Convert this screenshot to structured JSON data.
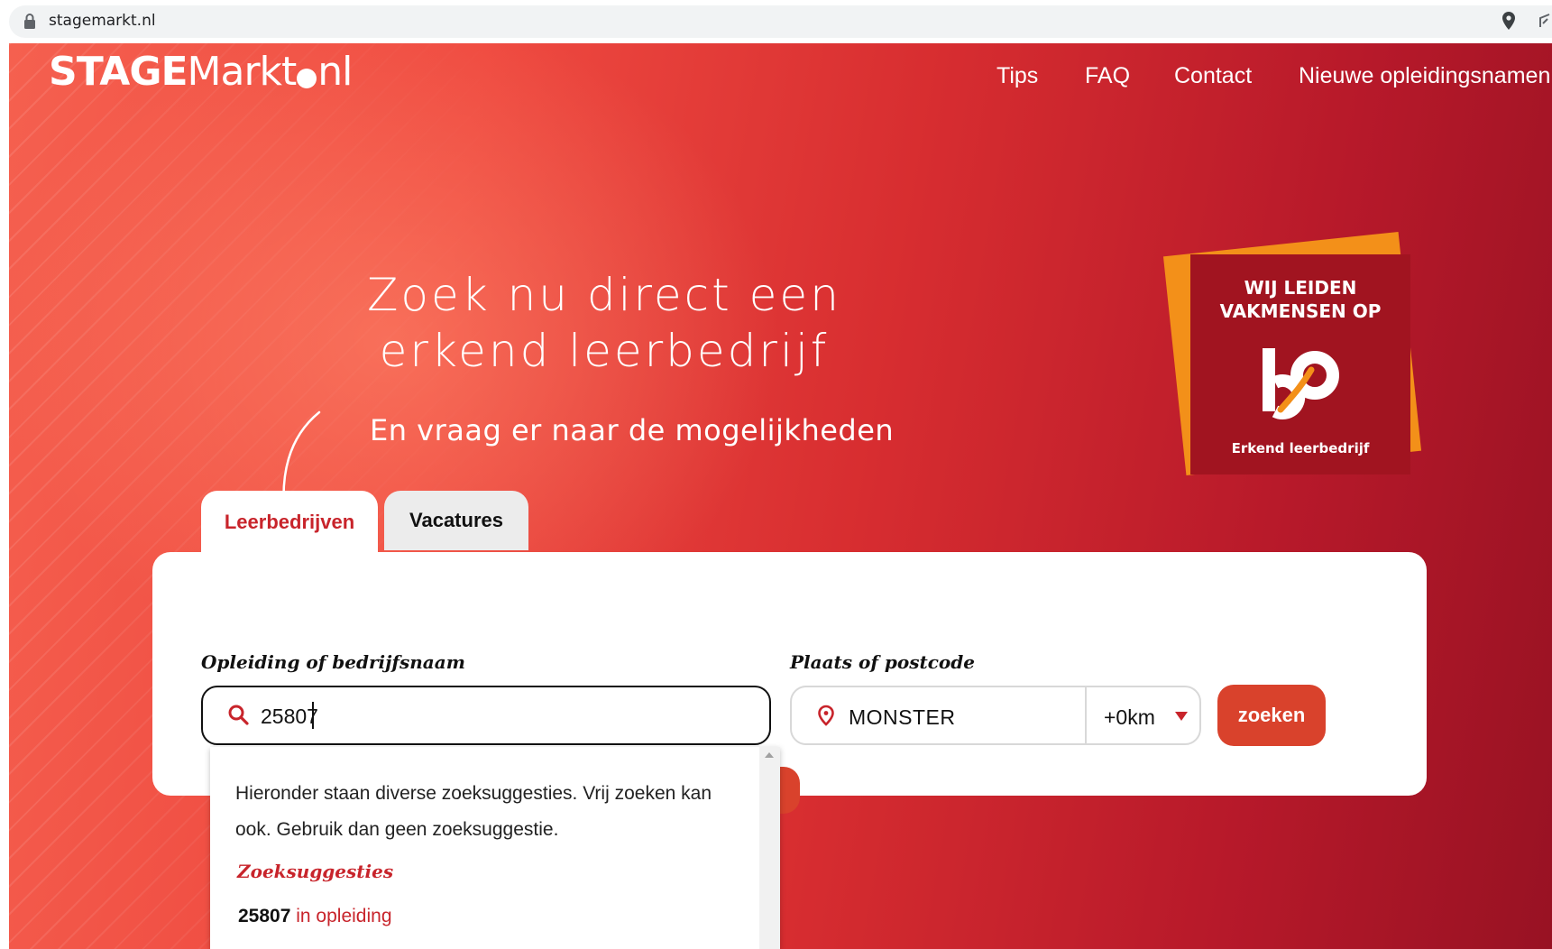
{
  "browser": {
    "url": "stagemarkt.nl"
  },
  "header": {
    "logo": {
      "stage": "STAGE",
      "markt": "Markt",
      "nl": "nl"
    },
    "nav": {
      "tips": "Tips",
      "faq": "FAQ",
      "contact": "Contact",
      "nieuwe": "Nieuwe opleidingsnamen"
    }
  },
  "hero": {
    "headline_line1": "Zoek nu direct een",
    "headline_line2": "erkend leerbedrijf",
    "subline": "En vraag er naar de mogelijkheden"
  },
  "badge": {
    "title_line1": "WIJ LEIDEN",
    "title_line2": "VAKMENSEN OP",
    "footer": "Erkend leerbedrijf",
    "colors": {
      "front": "#a11420",
      "back": "#f39019"
    }
  },
  "tabs": [
    {
      "label": "Leerbedrijven",
      "active": true
    },
    {
      "label": "Vacatures",
      "active": false
    }
  ],
  "search": {
    "opleiding_label": "Opleiding of bedrijfsnaam",
    "opleiding_value": "25807",
    "plaats_label": "Plaats of postcode",
    "plaats_value": "MONSTER",
    "radius_value": "+0km",
    "submit_label": "zoeken"
  },
  "suggestions": {
    "intro": "Hieronder staan diverse zoeksuggesties. Vrij zoeken kan ook. Gebruik dan geen zoeksuggestie.",
    "heading": "Zoeksuggesties",
    "items": [
      {
        "code": "25807",
        "suffix": "in opleiding"
      }
    ]
  },
  "colors": {
    "accent": "#c8242b",
    "button": "#d9422c"
  }
}
